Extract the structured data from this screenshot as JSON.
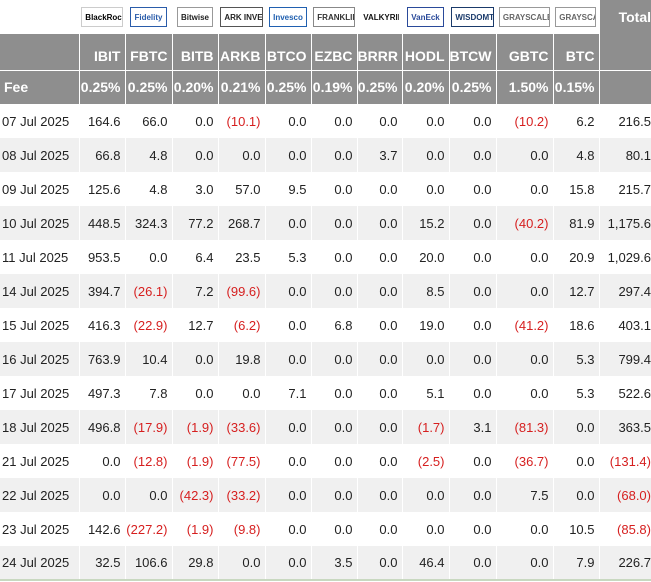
{
  "header": {
    "total_label": "Total",
    "fee_label": "Fee",
    "logos": [
      {
        "text": "BlackRock",
        "bg": "#ffffff",
        "fg": "#000000",
        "border": "#cccccc"
      },
      {
        "text": "Fidelity",
        "bg": "#ffffff",
        "fg": "#2a5caa",
        "border": "#2a5caa"
      },
      {
        "text": "Bitwise",
        "bg": "#ffffff",
        "fg": "#222222",
        "border": "#999999"
      },
      {
        "text": "ARK INVEST",
        "bg": "#ffffff",
        "fg": "#222222",
        "border": "#555555"
      },
      {
        "text": "Invesco",
        "bg": "#ffffff",
        "fg": "#2060b0",
        "border": "#2060b0"
      },
      {
        "text": "FRANKLIN TEMPLETON",
        "bg": "#ffffff",
        "fg": "#333333",
        "border": "#888888"
      },
      {
        "text": "VALKYRIE",
        "bg": "#ffffff",
        "fg": "#111111",
        "border": "#ffffff"
      },
      {
        "text": "VanEck",
        "bg": "#ffffff",
        "fg": "#2a4a9a",
        "border": "#2a4a9a"
      },
      {
        "text": "WISDOMTREE",
        "bg": "#ffffff",
        "fg": "#1a3a6a",
        "border": "#1a3a6a"
      },
      {
        "text": "GRAYSCALE",
        "bg": "#ffffff",
        "fg": "#666666",
        "border": "#999999"
      },
      {
        "text": "GRAYSCALE",
        "bg": "#ffffff",
        "fg": "#666666",
        "border": "#999999"
      }
    ],
    "tickers": [
      "IBIT",
      "FBTC",
      "BITB",
      "ARKB",
      "BTCO",
      "EZBC",
      "BRRR",
      "HODL",
      "BTCW",
      "GBTC",
      "BTC"
    ],
    "fees": [
      "0.25%",
      "0.25%",
      "0.20%",
      "0.21%",
      "0.25%",
      "0.19%",
      "0.25%",
      "0.20%",
      "0.25%",
      "1.50%",
      "0.15%"
    ]
  },
  "rows": [
    {
      "date": "07 Jul 2025",
      "cells": [
        "164.6",
        "66.0",
        "0.0",
        "(10.1)",
        "0.0",
        "0.0",
        "0.0",
        "0.0",
        "0.0",
        "(10.2)",
        "6.2"
      ],
      "total": "216.5"
    },
    {
      "date": "08 Jul 2025",
      "cells": [
        "66.8",
        "4.8",
        "0.0",
        "0.0",
        "0.0",
        "0.0",
        "3.7",
        "0.0",
        "0.0",
        "0.0",
        "4.8"
      ],
      "total": "80.1"
    },
    {
      "date": "09 Jul 2025",
      "cells": [
        "125.6",
        "4.8",
        "3.0",
        "57.0",
        "9.5",
        "0.0",
        "0.0",
        "0.0",
        "0.0",
        "0.0",
        "15.8"
      ],
      "total": "215.7"
    },
    {
      "date": "10 Jul 2025",
      "cells": [
        "448.5",
        "324.3",
        "77.2",
        "268.7",
        "0.0",
        "0.0",
        "0.0",
        "15.2",
        "0.0",
        "(40.2)",
        "81.9"
      ],
      "total": "1,175.6"
    },
    {
      "date": "11 Jul 2025",
      "cells": [
        "953.5",
        "0.0",
        "6.4",
        "23.5",
        "5.3",
        "0.0",
        "0.0",
        "20.0",
        "0.0",
        "0.0",
        "20.9"
      ],
      "total": "1,029.6"
    },
    {
      "date": "14 Jul 2025",
      "cells": [
        "394.7",
        "(26.1)",
        "7.2",
        "(99.6)",
        "0.0",
        "0.0",
        "0.0",
        "8.5",
        "0.0",
        "0.0",
        "12.7"
      ],
      "total": "297.4"
    },
    {
      "date": "15 Jul 2025",
      "cells": [
        "416.3",
        "(22.9)",
        "12.7",
        "(6.2)",
        "0.0",
        "6.8",
        "0.0",
        "19.0",
        "0.0",
        "(41.2)",
        "18.6"
      ],
      "total": "403.1"
    },
    {
      "date": "16 Jul 2025",
      "cells": [
        "763.9",
        "10.4",
        "0.0",
        "19.8",
        "0.0",
        "0.0",
        "0.0",
        "0.0",
        "0.0",
        "0.0",
        "5.3"
      ],
      "total": "799.4"
    },
    {
      "date": "17 Jul 2025",
      "cells": [
        "497.3",
        "7.8",
        "0.0",
        "0.0",
        "7.1",
        "0.0",
        "0.0",
        "5.1",
        "0.0",
        "0.0",
        "5.3"
      ],
      "total": "522.6"
    },
    {
      "date": "18 Jul 2025",
      "cells": [
        "496.8",
        "(17.9)",
        "(1.9)",
        "(33.6)",
        "0.0",
        "0.0",
        "0.0",
        "(1.7)",
        "3.1",
        "(81.3)",
        "0.0"
      ],
      "total": "363.5"
    },
    {
      "date": "21 Jul 2025",
      "cells": [
        "0.0",
        "(12.8)",
        "(1.9)",
        "(77.5)",
        "0.0",
        "0.0",
        "0.0",
        "(2.5)",
        "0.0",
        "(36.7)",
        "0.0"
      ],
      "total": "(131.4)"
    },
    {
      "date": "22 Jul 2025",
      "cells": [
        "0.0",
        "0.0",
        "(42.3)",
        "(33.2)",
        "0.0",
        "0.0",
        "0.0",
        "0.0",
        "0.0",
        "7.5",
        "0.0"
      ],
      "total": "(68.0)"
    },
    {
      "date": "23 Jul 2025",
      "cells": [
        "142.6",
        "(227.2)",
        "(1.9)",
        "(9.8)",
        "0.0",
        "0.0",
        "0.0",
        "0.0",
        "0.0",
        "0.0",
        "10.5"
      ],
      "total": "(85.8)"
    },
    {
      "date": "24 Jul 2025",
      "cells": [
        "32.5",
        "106.6",
        "29.8",
        "0.0",
        "0.0",
        "3.5",
        "0.0",
        "46.4",
        "0.0",
        "0.0",
        "7.9"
      ],
      "total": "226.7"
    }
  ],
  "colors": {
    "header_bg": "#8e8e8e",
    "negative": "#d61f1f",
    "stripe": "#f0f0f0"
  }
}
